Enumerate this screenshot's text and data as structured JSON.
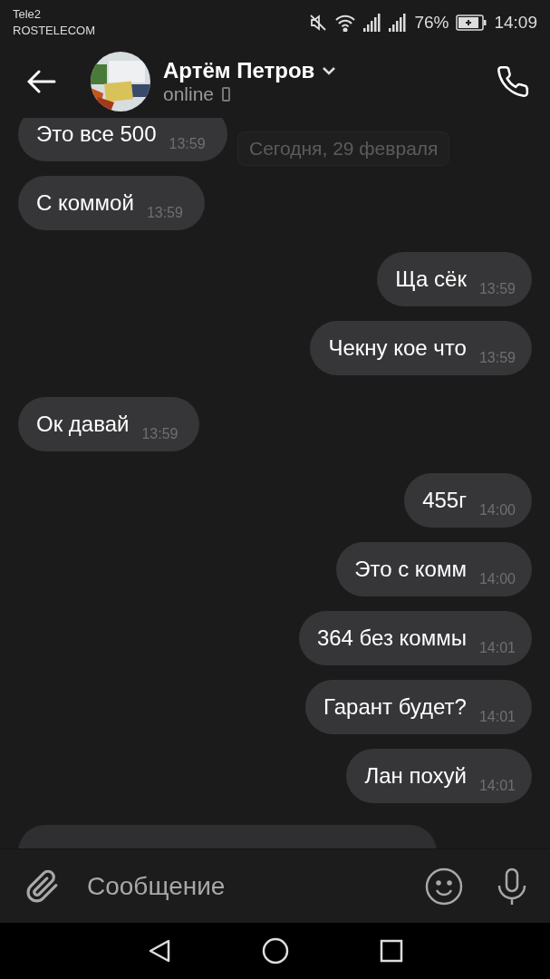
{
  "status_bar": {
    "carrier_1": "Tele2",
    "carrier_2": "ROSTELECOM",
    "battery": "76%",
    "time": "14:09"
  },
  "header": {
    "name": "Артём Петров",
    "status": "online"
  },
  "date_label": "Сегодня, 29 февраля",
  "messages": [
    {
      "kind": "in",
      "text": "Это все 500",
      "time": "13:59"
    },
    {
      "kind": "in",
      "text": "С коммой",
      "time": "13:59"
    },
    {
      "kind": "out",
      "text": "Ща сёк",
      "time": "13:59"
    },
    {
      "kind": "out",
      "text": "Чекну кое что",
      "time": "13:59"
    },
    {
      "kind": "in",
      "text": "Ок давай",
      "time": "13:59"
    },
    {
      "kind": "out",
      "text": "455г",
      "time": "14:00"
    },
    {
      "kind": "out",
      "text": "Это с комм",
      "time": "14:00"
    },
    {
      "kind": "out",
      "text": "364 без коммы",
      "time": "14:01"
    },
    {
      "kind": "out",
      "text": "Гарант будет?",
      "time": "14:01"
    },
    {
      "kind": "out",
      "text": "Лан похуй",
      "time": "14:01"
    },
    {
      "kind": "partial"
    }
  ],
  "composer": {
    "placeholder": "Сообщение"
  }
}
